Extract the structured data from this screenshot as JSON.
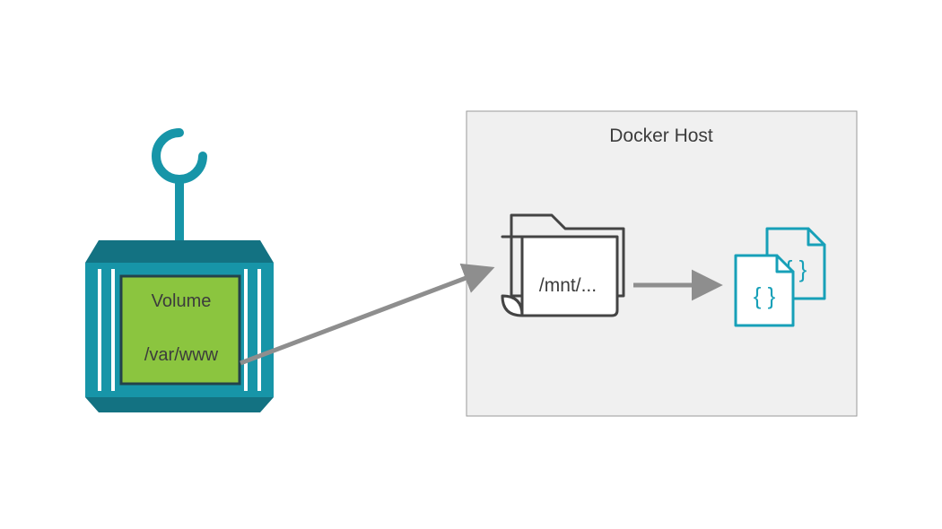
{
  "container": {
    "label_top": "Volume",
    "label_bottom": "/var/www"
  },
  "host": {
    "title": "Docker Host",
    "folder_label": "/mnt/...",
    "file_glyph": "{ }"
  },
  "colors": {
    "teal": "#1795a8",
    "teal_dark": "#137282",
    "green": "#8bc53f",
    "panel_bg": "#f0f0f0",
    "panel_border": "#9a9a9a",
    "arrow": "#8e8e8e",
    "folder_stroke": "#444444",
    "file_stroke": "#17a0b8",
    "text": "#3c3c3c"
  }
}
